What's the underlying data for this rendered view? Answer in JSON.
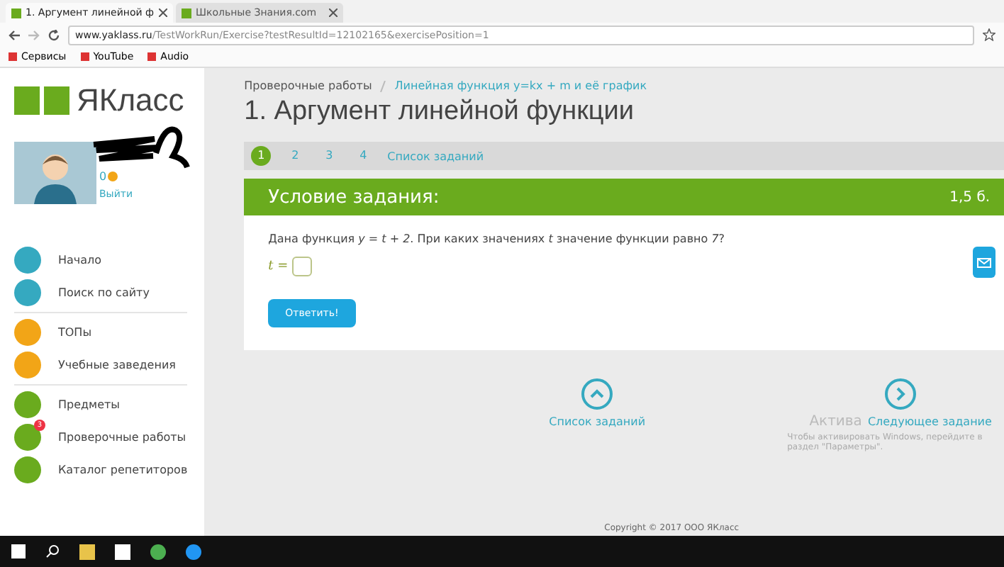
{
  "browser": {
    "tabs": [
      {
        "title": "1. Аргумент линейной ф",
        "selected": true
      },
      {
        "title": "Школьные Знания.com",
        "selected": false
      }
    ],
    "url_host": "www.yaklass.ru",
    "url_path": "/TestWorkRun/Exercise?testResultId=12102165&exercisePosition=1",
    "bookmarks": [
      "Сервисы",
      "YouTube",
      "Audio"
    ]
  },
  "sidebar": {
    "logo": "ЯКласс",
    "score": "0",
    "logout": "Выйти",
    "groups": [
      [
        {
          "label": "Начало",
          "color": "#35a9c0"
        },
        {
          "label": "Поиск по сайту",
          "color": "#35a9c0"
        }
      ],
      [
        {
          "label": "ТОПы",
          "color": "#f2a517"
        },
        {
          "label": "Учебные заведения",
          "color": "#f2a517"
        }
      ],
      [
        {
          "label": "Предметы",
          "color": "#6aab1e"
        },
        {
          "label": "Проверочные работы",
          "color": "#6aab1e",
          "badge": "3"
        },
        {
          "label": "Каталог репетиторов",
          "color": "#6aab1e"
        }
      ]
    ]
  },
  "breadcrumb": [
    "Проверочные работы",
    "Линейная функция y=kx + m и её график"
  ],
  "title": "1. Аргумент линейной функции",
  "pager": {
    "pages": [
      {
        "label": "1",
        "selected": true
      },
      {
        "label": "2",
        "selected": false
      },
      {
        "label": "3",
        "selected": false
      },
      {
        "label": "4",
        "selected": false
      }
    ],
    "list_link": "Список заданий"
  },
  "task": {
    "header": "Условие задания:",
    "points": "1,5 б.",
    "question": "Дана функция *y = t + 2*. При каких значениях *t* значение функции равно *7*?",
    "answer_label": "t =",
    "submit": "Ответить!"
  },
  "nav": {
    "list": "Список заданий",
    "next": "Следующее задание"
  },
  "activation": {
    "title": "Актива",
    "text": "Чтобы активировать Windows, перейдите в раздел \"Параметры\"."
  },
  "copyright": "Copyright © 2017 ООО ЯКласс"
}
